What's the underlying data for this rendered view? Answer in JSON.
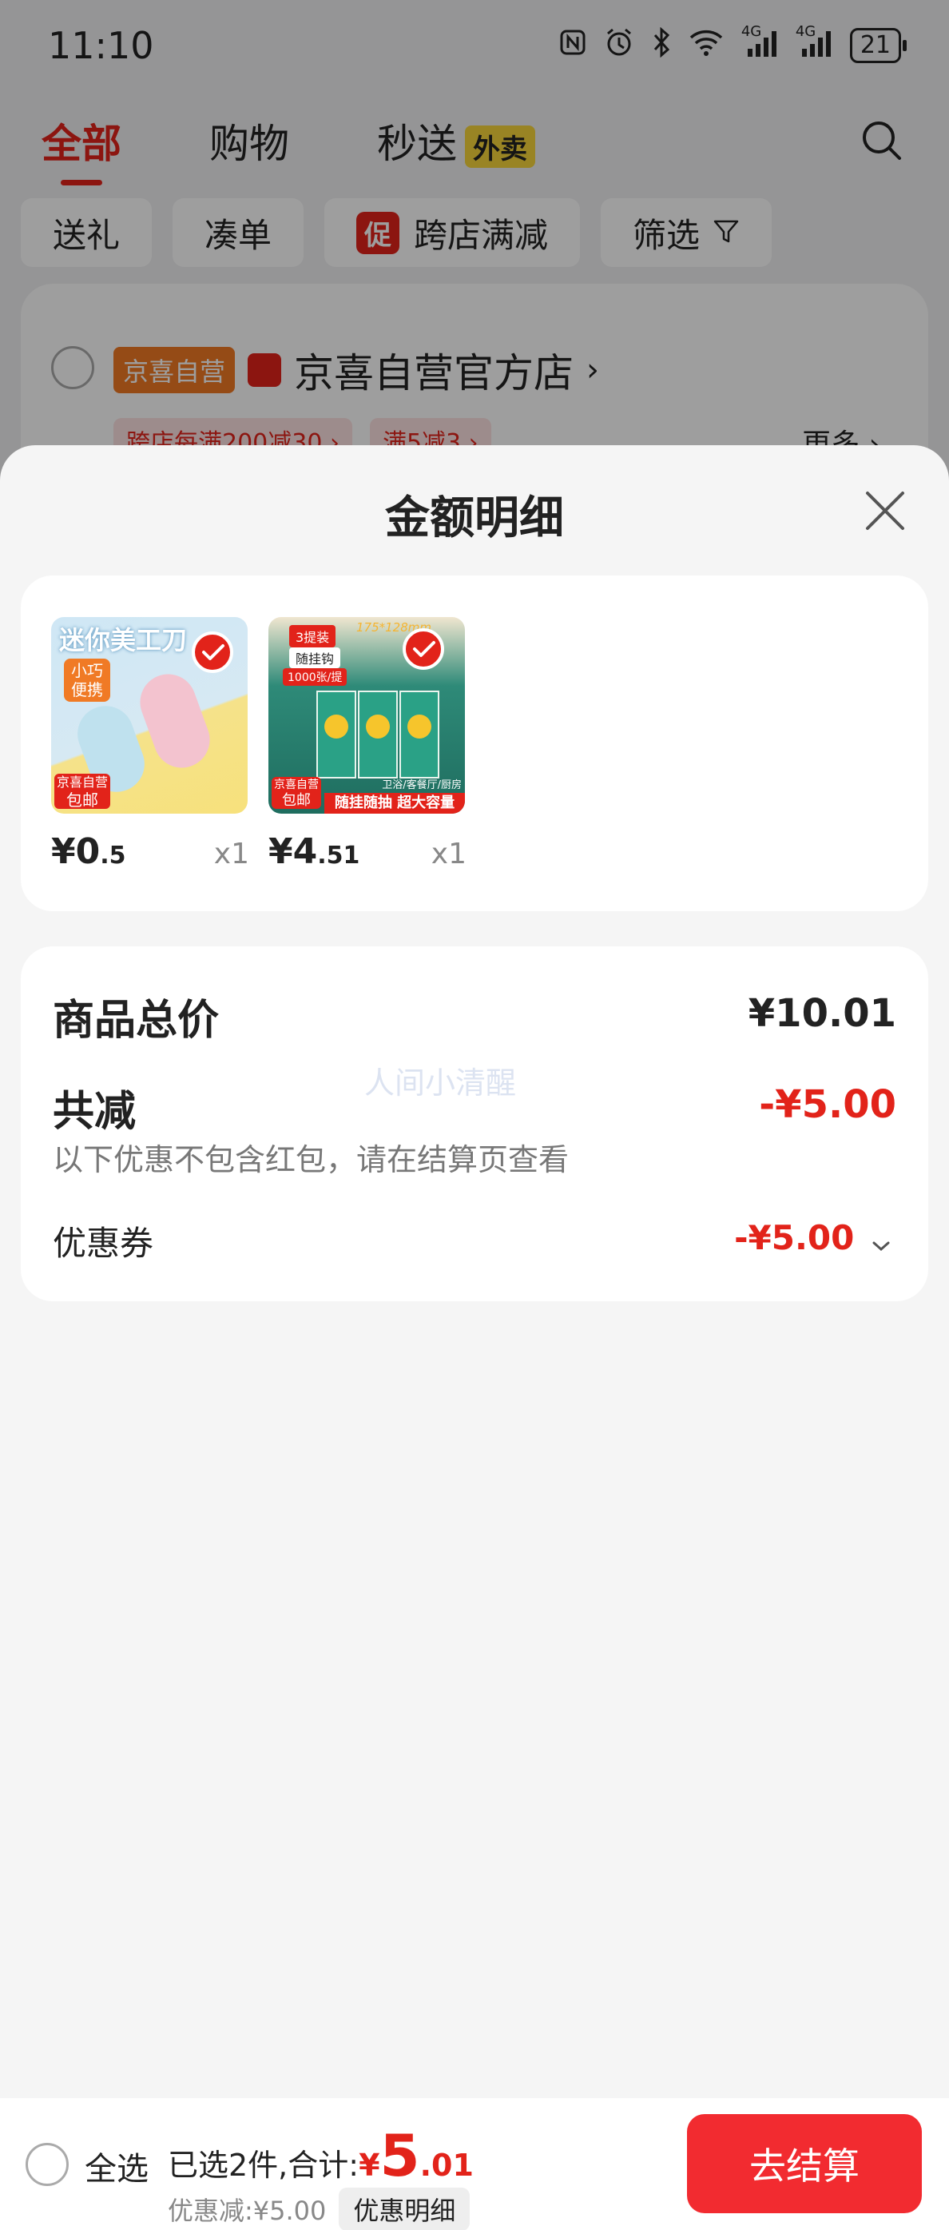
{
  "status_bar": {
    "time": "11:10",
    "battery": "21",
    "network_labels": [
      "4G",
      "4G"
    ]
  },
  "tabs": [
    {
      "label": "全部"
    },
    {
      "label": "购物"
    },
    {
      "label": "秒送",
      "badge": "外卖"
    }
  ],
  "chips": [
    "送礼",
    "凑单",
    "跨店满减",
    "筛选"
  ],
  "chip_promo_badge": "促",
  "store": {
    "tag": "京喜自营",
    "name": "京喜自营官方店",
    "promos": [
      "跨店每满200减30 ›",
      "满5减3 ›"
    ],
    "more": "更多 ›"
  },
  "sheet": {
    "title": "金额明细",
    "products": [
      {
        "title": "迷你美工刀",
        "tag_small": "小巧便携",
        "corner_line1": "京喜自营",
        "corner_line2": "包邮",
        "price_int": "¥0",
        "price_dec": ".5",
        "qty": "x1"
      },
      {
        "title": "3提装",
        "tag_small": "随挂钩",
        "sub": "1000张/提",
        "size": "175*128mm",
        "corner_line1": "京喜自营",
        "corner_line2": "包邮",
        "footer": "随挂随抽 超大容量",
        "footer_small": "卫浴/客餐厅/厨房",
        "price_int": "¥4",
        "price_dec": ".51",
        "qty": "x1"
      }
    ],
    "summary": {
      "total_label": "商品总价",
      "total_value": "¥10.01",
      "reduce_label": "共减",
      "reduce_value": "-¥5.00",
      "note": "以下优惠不包含红包，请在结算页查看",
      "coupon_label": "优惠券",
      "coupon_value": "-¥5.00",
      "watermark": "人间小清醒"
    }
  },
  "bottom_bar": {
    "select_all": "全选",
    "selected_prefix": "已选2件,合计:",
    "total_currency": "¥",
    "total_int": "5",
    "total_dec": ".01",
    "discount": "优惠减:¥5.00",
    "detail_button": "优惠明细",
    "checkout": "去结算"
  },
  "colors": {
    "accent_red": "#e2231a",
    "checkout_red": "#f22b30",
    "self_tag_orange": "#f07a25",
    "waimai_yellow": "#f7d63a"
  }
}
